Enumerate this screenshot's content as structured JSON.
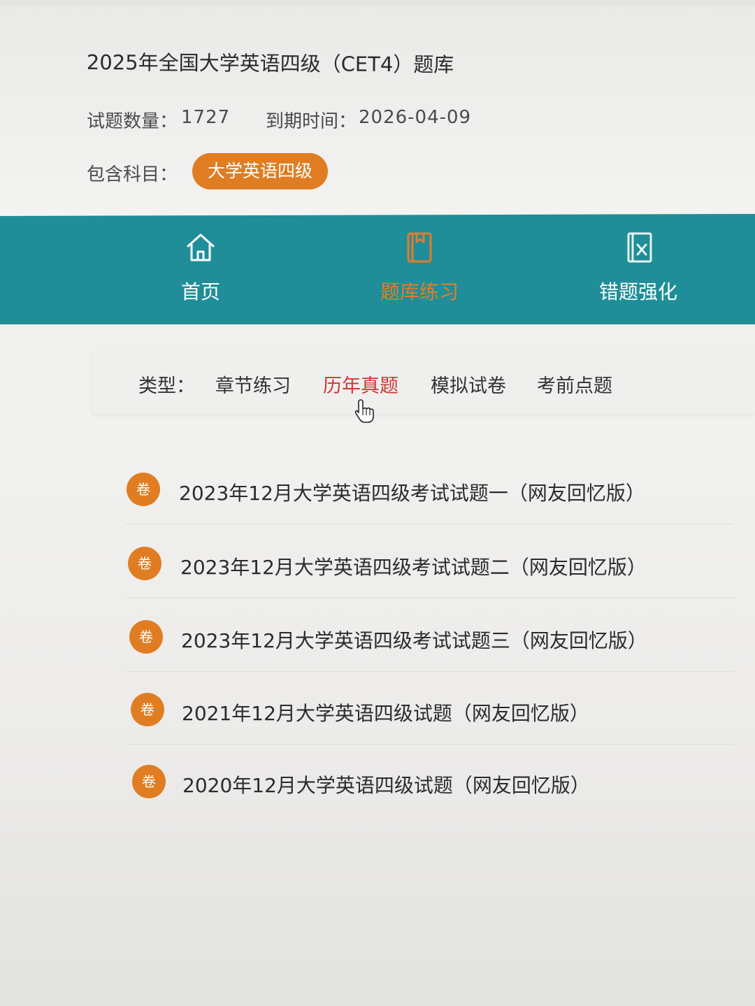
{
  "header": {
    "title": "2025年全国大学英语四级（CET4）题库",
    "count_label": "试题数量：",
    "count_value": "1727",
    "expiry_label": "到期时间：",
    "expiry_value": "2026-04-09",
    "subjects_label": "包含科目：",
    "subject_badge": "大学英语四级"
  },
  "nav": {
    "items": [
      {
        "label": "首页",
        "icon": "home-icon",
        "active": false
      },
      {
        "label": "题库练习",
        "icon": "book-icon",
        "active": true
      },
      {
        "label": "错题强化",
        "icon": "wrong-question-icon",
        "active": false
      }
    ],
    "background": "#1f8e98",
    "active_color": "#e27d2a",
    "inactive_color": "#ffffff"
  },
  "filter": {
    "label": "类型：",
    "options": [
      {
        "label": "章节练习",
        "active": false
      },
      {
        "label": "历年真题",
        "active": true
      },
      {
        "label": "模拟试卷",
        "active": false
      },
      {
        "label": "考前点题",
        "active": false
      }
    ],
    "active_color": "#c93a34"
  },
  "papers": {
    "badge": "卷",
    "badge_color": "#e07d22",
    "items": [
      {
        "title": "2023年12月大学英语四级考试试题一（网友回忆版）"
      },
      {
        "title": "2023年12月大学英语四级考试试题二（网友回忆版）"
      },
      {
        "title": "2023年12月大学英语四级考试试题三（网友回忆版）"
      },
      {
        "title": "2021年12月大学英语四级试题（网友回忆版）"
      },
      {
        "title": "2020年12月大学英语四级试题（网友回忆版）"
      }
    ]
  },
  "cursor_icon": "pointer-hand-icon"
}
